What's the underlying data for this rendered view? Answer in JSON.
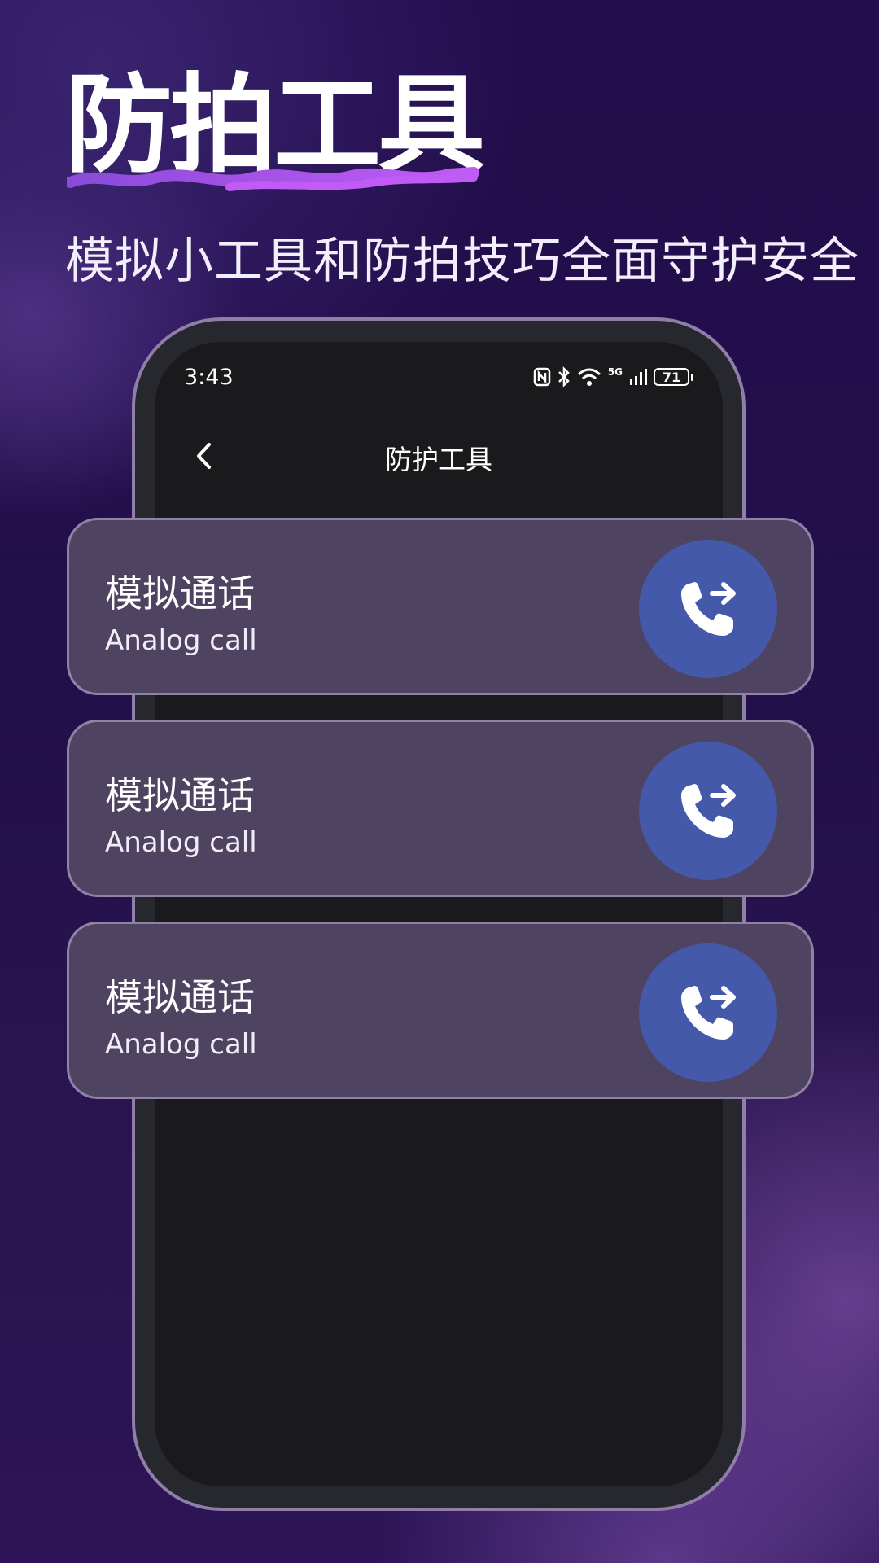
{
  "hero": {
    "title": "防拍工具",
    "subtitle": "模拟小工具和防拍技巧全面守护安全"
  },
  "status_bar": {
    "time": "3:43",
    "network": "5G",
    "battery": "71"
  },
  "nav": {
    "title": "防护工具"
  },
  "cards": [
    {
      "title": "模拟通话",
      "subtitle": "Analog call",
      "icon": "phone-forward-icon"
    },
    {
      "title": "模拟通话",
      "subtitle": "Analog call",
      "icon": "phone-forward-icon"
    },
    {
      "title": "模拟通话",
      "subtitle": "Analog call",
      "icon": "phone-forward-icon"
    }
  ],
  "colors": {
    "background": "#230d4d",
    "card": "#4e4360",
    "call_button": "#4459a9",
    "underline": "#b35cf0"
  }
}
